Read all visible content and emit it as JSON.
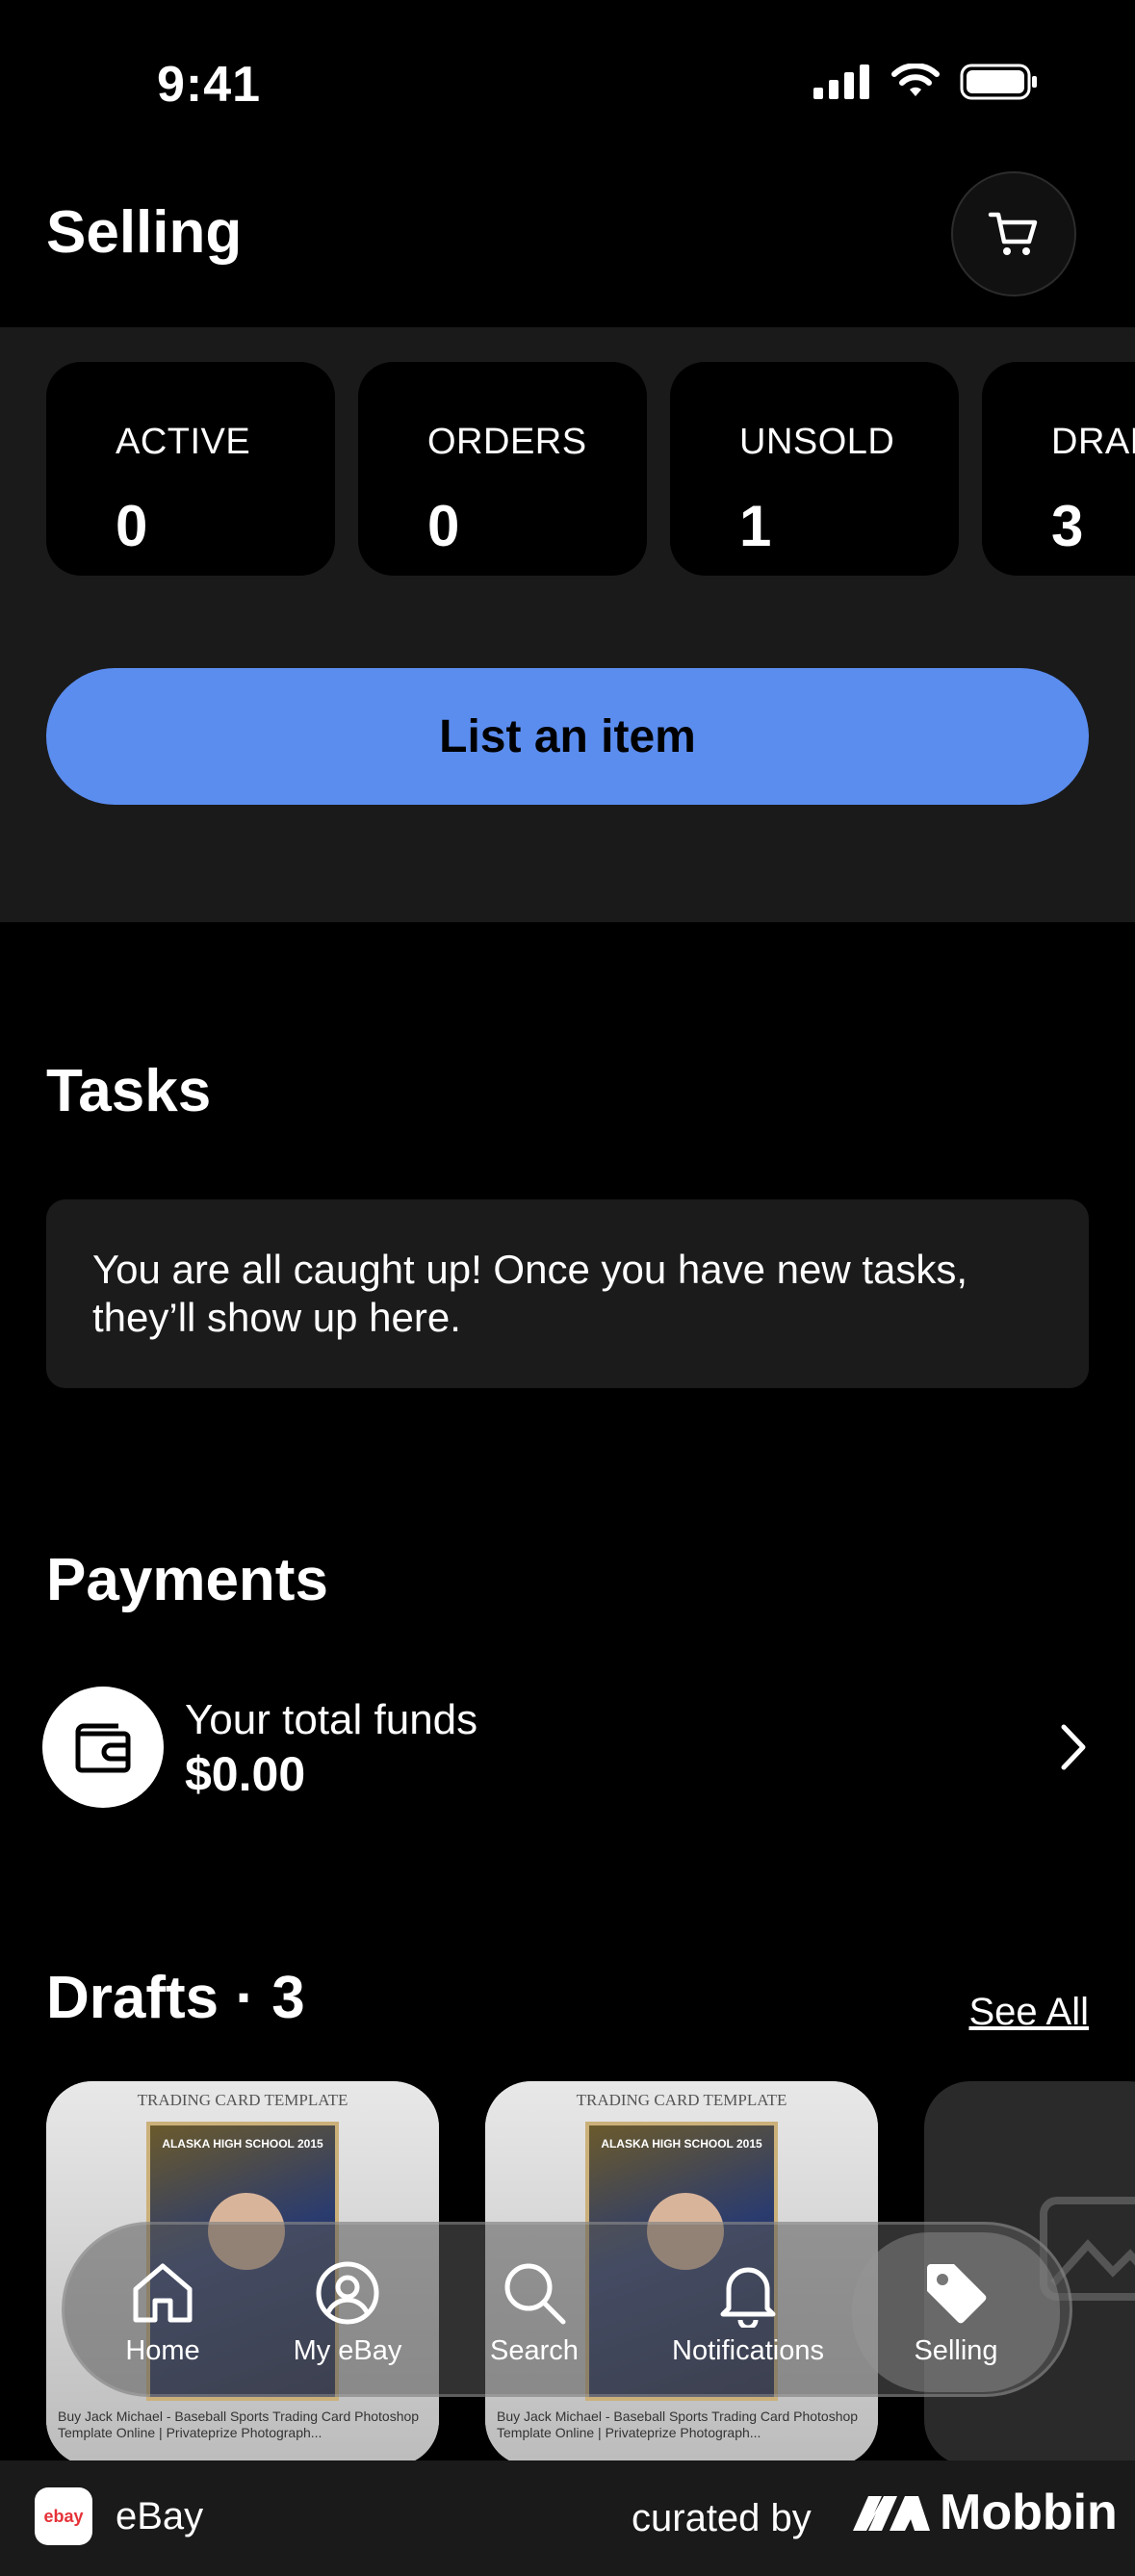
{
  "status_bar": {
    "time": "9:41"
  },
  "header": {
    "title": "Selling"
  },
  "stats": [
    {
      "label": "ACTIVE",
      "value": "0"
    },
    {
      "label": "ORDERS",
      "value": "0"
    },
    {
      "label": "UNSOLD",
      "value": "1"
    },
    {
      "label": "DRAFTS",
      "value": "3"
    }
  ],
  "list_button": {
    "label": "List an item"
  },
  "tasks": {
    "title": "Tasks",
    "message": "You are all caught up! Once you have new tasks, they’ll show up here."
  },
  "payments": {
    "title": "Payments",
    "funds_label": "Your total funds",
    "funds_amount": "$0.00"
  },
  "drafts": {
    "title": "Drafts · 3",
    "see_all": "See All",
    "items": [
      {
        "template_label": "TRADING CARD TEMPLATE",
        "card_title": "ALASKA HIGH SCHOOL 2015",
        "caption": "Buy Jack Michael - Baseball Sports Trading Card Photoshop Template Online | Privateprize Photograph..."
      },
      {
        "template_label": "TRADING CARD TEMPLATE",
        "card_title": "ALASKA HIGH SCHOOL 2015",
        "caption": "Buy Jack Michael - Baseball Sports Trading Card Photoshop Template Online | Privateprize Photograph..."
      }
    ]
  },
  "tab_bar": {
    "items": [
      {
        "label": "Home",
        "icon": "home-icon"
      },
      {
        "label": "My eBay",
        "icon": "profile-icon"
      },
      {
        "label": "Search",
        "icon": "search-icon"
      },
      {
        "label": "Notifications",
        "icon": "bell-icon"
      },
      {
        "label": "Selling",
        "icon": "tag-icon",
        "active": true
      }
    ]
  },
  "footer": {
    "logo_text": "ebay",
    "app_name": "eBay",
    "curated_by": "curated by",
    "brand": "Mobbin"
  },
  "colors": {
    "accent": "#5b8def",
    "background": "#000000",
    "panel": "#1a1a1a"
  }
}
